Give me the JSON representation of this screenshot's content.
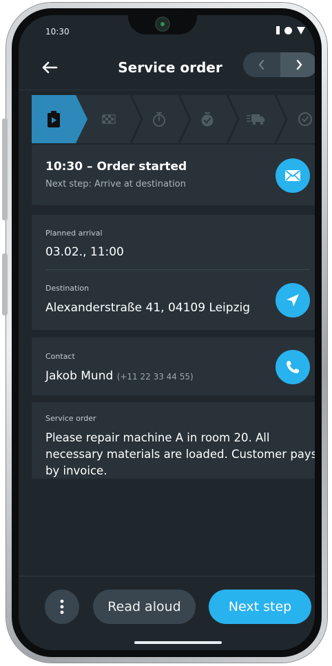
{
  "status_bar": {
    "time": "10:30"
  },
  "header": {
    "title": "Service order"
  },
  "status": {
    "title": "10:30 – Order started",
    "subtitle": "Next step: Arrive at destination"
  },
  "route": {
    "planned_arrival_label": "Planned arrival",
    "planned_arrival_value": "03.02., 11:00",
    "destination_label": "Destination",
    "destination_value": "Alexanderstraße 41, 04109 Leipzig"
  },
  "contact": {
    "label": "Contact",
    "name": "Jakob Mund",
    "phone": "(+11 22 33 44 55)"
  },
  "order": {
    "label": "Service order",
    "text": "Please repair machine A in room 20. All necessary materials are loaded. Customer pays by invoice."
  },
  "actions": {
    "read_aloud": "Read aloud",
    "next_step": "Next step"
  },
  "steps": [
    {
      "icon": "clipboard-play-icon",
      "state": "active"
    },
    {
      "icon": "checkered-flag-icon",
      "state": "pending"
    },
    {
      "icon": "stopwatch-icon",
      "state": "pending"
    },
    {
      "icon": "stopwatch-check-icon",
      "state": "pending"
    },
    {
      "icon": "delivery-truck-icon",
      "state": "pending"
    },
    {
      "icon": "check-circle-icon",
      "state": "pending"
    }
  ],
  "colors": {
    "accent": "#28b2ee",
    "active_step": "#2d89ba",
    "background": "#1f272d",
    "card": "#283238"
  }
}
